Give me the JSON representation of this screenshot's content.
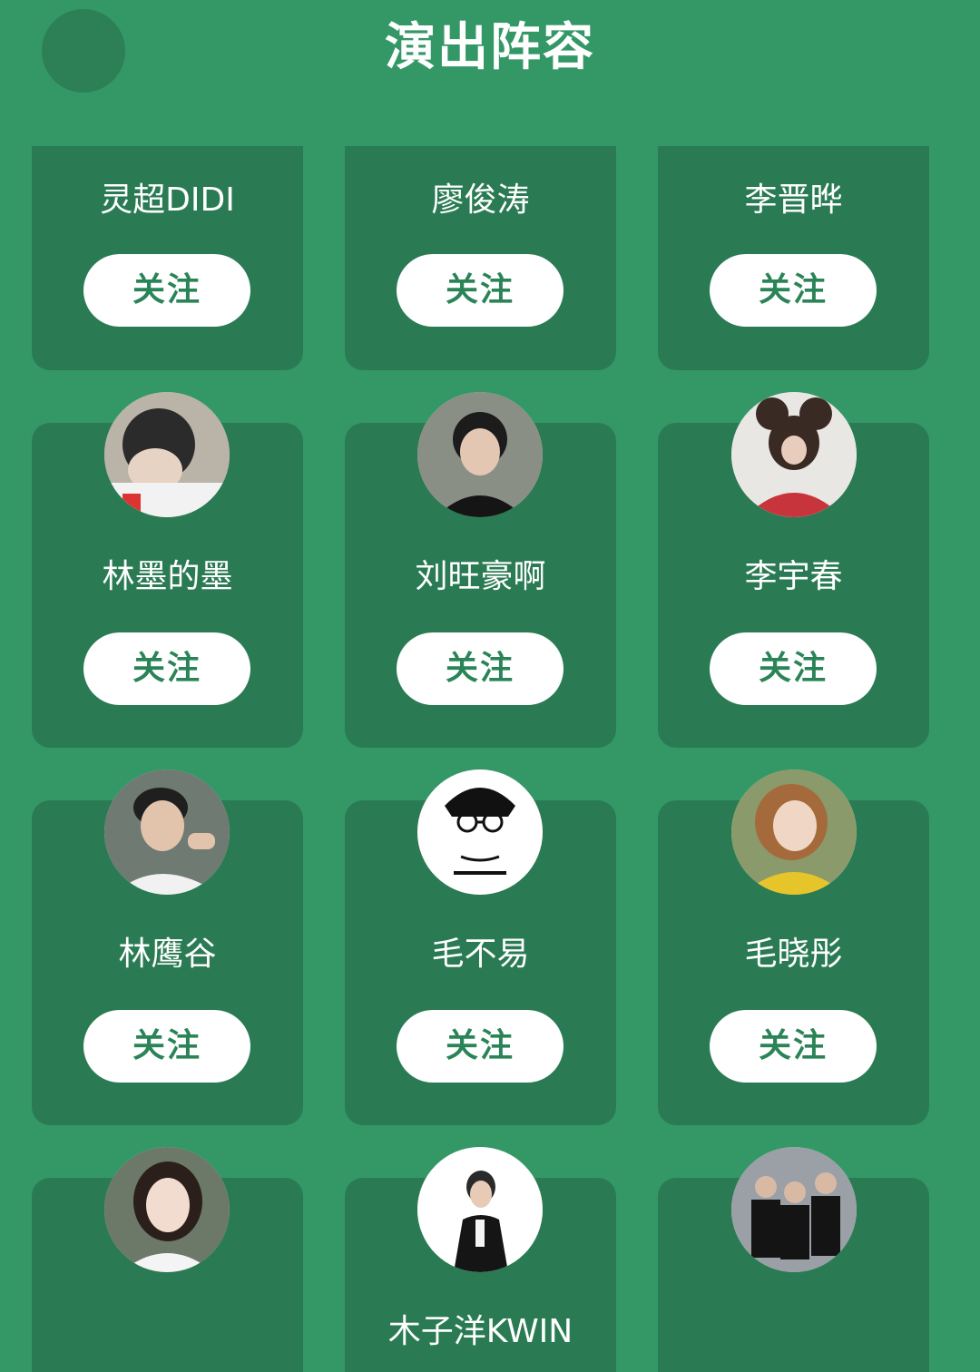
{
  "header": {
    "title": "演出阵容",
    "back_icon": "back-icon"
  },
  "colors": {
    "background": "#339866",
    "card": "#2a7b53",
    "button_bg": "#ffffff",
    "button_text": "#2a8457"
  },
  "artists": [
    {
      "name": "灵超DIDI",
      "follow_label": "关注",
      "avatar": false
    },
    {
      "name": "廖俊涛",
      "follow_label": "关注",
      "avatar": false
    },
    {
      "name": "李晋晔",
      "follow_label": "关注",
      "avatar": false
    },
    {
      "name": "林墨的墨",
      "follow_label": "关注",
      "avatar": true
    },
    {
      "name": "刘旺豪啊",
      "follow_label": "关注",
      "avatar": true
    },
    {
      "name": "李宇春",
      "follow_label": "关注",
      "avatar": true
    },
    {
      "name": "林鹰谷",
      "follow_label": "关注",
      "avatar": true
    },
    {
      "name": "毛不易",
      "follow_label": "关注",
      "avatar": true
    },
    {
      "name": "毛晓彤",
      "follow_label": "关注",
      "avatar": true
    },
    {
      "name": "",
      "follow_label": "",
      "avatar": true
    },
    {
      "name": "木子洋KWIN",
      "follow_label": "",
      "avatar": true
    },
    {
      "name": "",
      "follow_label": "",
      "avatar": true
    }
  ]
}
